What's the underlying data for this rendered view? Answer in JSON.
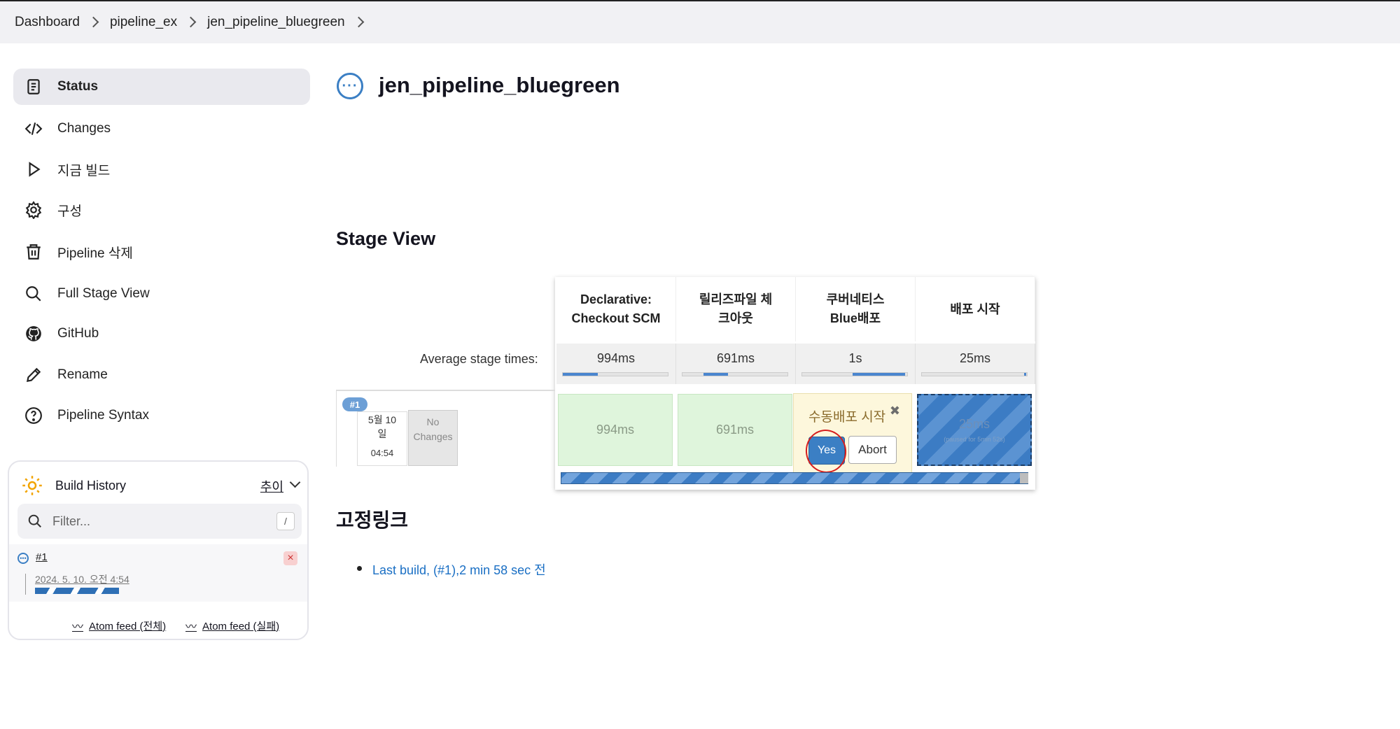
{
  "breadcrumb": [
    "Dashboard",
    "pipeline_ex",
    "jen_pipeline_bluegreen"
  ],
  "sidebar": {
    "items": [
      {
        "label": "Status",
        "icon": "status-icon"
      },
      {
        "label": "Changes",
        "icon": "code-icon"
      },
      {
        "label": "지금 빌드",
        "icon": "play-icon"
      },
      {
        "label": "구성",
        "icon": "gear-icon"
      },
      {
        "label": "Pipeline 삭제",
        "icon": "trash-icon"
      },
      {
        "label": "Full Stage View",
        "icon": "search-icon"
      },
      {
        "label": "GitHub",
        "icon": "github-icon"
      },
      {
        "label": "Rename",
        "icon": "pencil-icon"
      },
      {
        "label": "Pipeline Syntax",
        "icon": "help-icon"
      }
    ]
  },
  "build_history": {
    "title": "Build History",
    "trend": "추이",
    "filter_placeholder": "Filter...",
    "filter_shortcut": "/",
    "builds": [
      {
        "number": "#1",
        "date": "2024. 5. 10. 오전 4:54"
      }
    ],
    "feeds": [
      "Atom feed (전체)",
      "Atom feed (실패)"
    ]
  },
  "main": {
    "title": "jen_pipeline_bluegreen",
    "stage_view_title": "Stage View",
    "avg_label": "Average stage times:",
    "stages": [
      {
        "name_line1": "Declarative:",
        "name_line2": "Checkout SCM",
        "avg": "994ms",
        "run": "994ms",
        "avg_fill": 0.33
      },
      {
        "name_line1": "릴리즈파일 체",
        "name_line2": "크아웃",
        "avg": "691ms",
        "run": "691ms",
        "avg_fill": 0.23
      },
      {
        "name_line1": "쿠버네티스",
        "name_line2": "Blue배포",
        "avg": "1s",
        "run": "",
        "avg_fill": 0.5
      },
      {
        "name_line1": "배포 시작",
        "name_line2": "",
        "avg": "25ms",
        "run": "25ms",
        "run_sub": "(paused for 5min 52s)",
        "avg_fill": 0.02
      }
    ],
    "build": {
      "badge": "#1",
      "date_line1": "5월 10",
      "date_line2": "일",
      "time": "04:54",
      "changes_line1": "No",
      "changes_line2": "Changes"
    },
    "input_prompt": {
      "message": "수동배포 시작",
      "yes_label": "Yes",
      "abort_label": "Abort",
      "close_glyph": "✖"
    },
    "permalinks_title": "고정링크",
    "permalinks": [
      "Last build, (#1),2 min 58 sec 전"
    ]
  },
  "colors": {
    "accent": "#3b7fc4",
    "success_bg": "#dff5dc",
    "paused": "#3c7cc4",
    "prompt_bg": "#fdf7dc",
    "annotation_red": "#d51d1d"
  }
}
